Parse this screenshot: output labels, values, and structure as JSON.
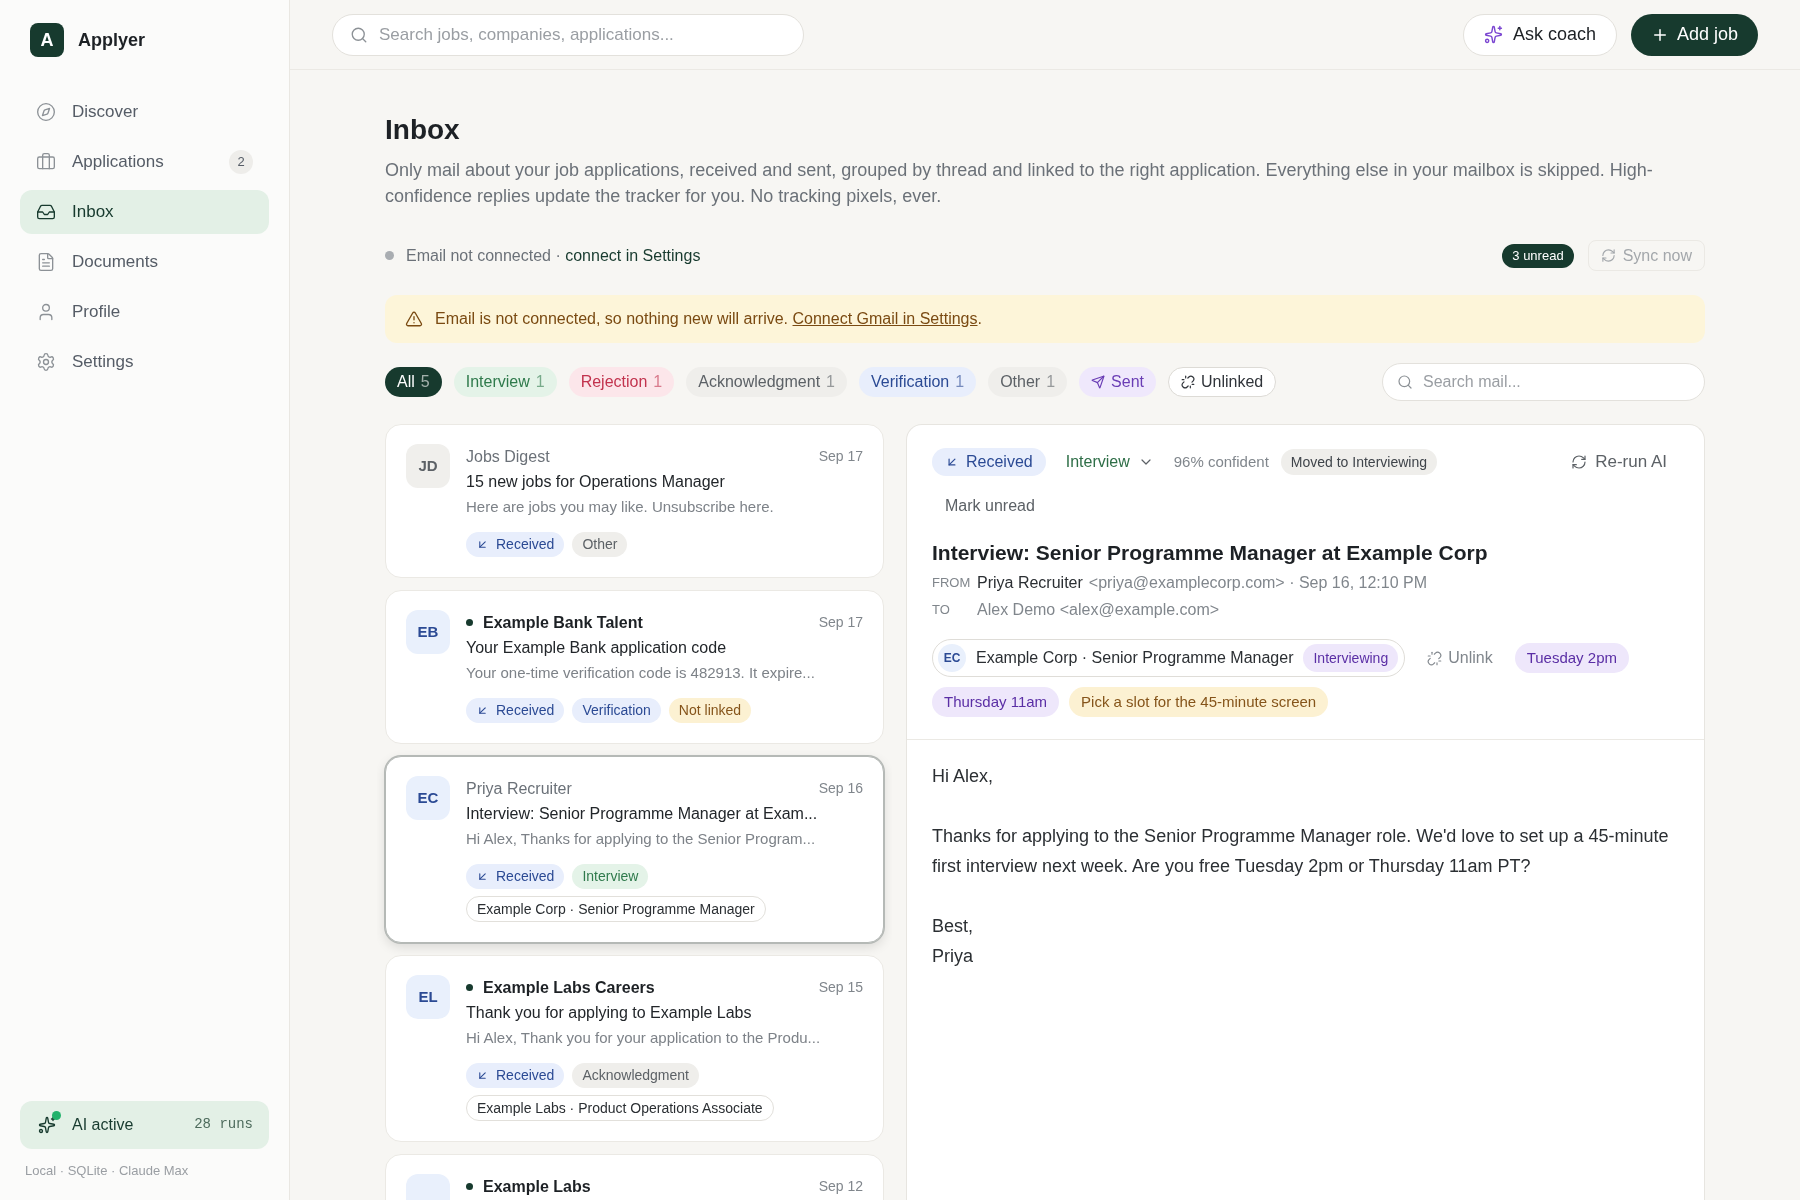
{
  "app": {
    "logo": "A",
    "name": "Applyer"
  },
  "sidebar": {
    "items": [
      {
        "label": "Discover",
        "selected": false
      },
      {
        "label": "Applications",
        "badge": "2",
        "selected": false
      },
      {
        "label": "Inbox",
        "selected": true
      },
      {
        "label": "Documents",
        "selected": false
      },
      {
        "label": "Profile",
        "selected": false
      },
      {
        "label": "Settings",
        "selected": false
      }
    ],
    "ai_status": {
      "label": "AI active",
      "runs": "28 runs",
      "active": true
    },
    "footer": "Local · SQLite · Claude Max"
  },
  "topbar": {
    "search": {
      "placeholder": "Search jobs, companies, applications..."
    },
    "buttons": [
      {
        "label": "Ask coach",
        "kind": "secondary"
      },
      {
        "label": "Add job",
        "kind": "primary"
      }
    ]
  },
  "page": {
    "title": "Inbox",
    "description": "Only mail about your job applications, received and sent, grouped by thread and linked to the right application. Everything else in your mailbox is skipped. High-confidence replies update the tracker for you. No tracking pixels, ever.",
    "connection": {
      "connected": false,
      "status": "Email not connected ·",
      "link": "connect in Settings"
    },
    "unread": "3 unread",
    "sync": {
      "label": "Sync now",
      "disabled": true
    },
    "alert": {
      "text": "Email is not connected, so nothing new will arrive.",
      "link": "Connect Gmail in Settings",
      "after": "."
    }
  },
  "filters": {
    "tabs": [
      {
        "label": "All",
        "count": "5",
        "kind": "all",
        "selected": true
      },
      {
        "label": "Interview",
        "count": "1",
        "kind": "interview",
        "selected": false
      },
      {
        "label": "Rejection",
        "count": "1",
        "kind": "rejection",
        "selected": false
      },
      {
        "label": "Acknowledgment",
        "count": "1",
        "kind": "neutral",
        "selected": false
      },
      {
        "label": "Verification",
        "count": "1",
        "kind": "verification",
        "selected": false
      },
      {
        "label": "Other",
        "count": "1",
        "kind": "neutral",
        "selected": false
      },
      {
        "label": "Sent",
        "kind": "sent",
        "selected": false
      },
      {
        "label": "Unlinked",
        "kind": "unlinked",
        "selected": false
      }
    ],
    "search": {
      "placeholder": "Search mail..."
    }
  },
  "messages": [
    {
      "avatar": {
        "initials": "JD",
        "kind": "neutral"
      },
      "sender": "Jobs Digest",
      "date": "Sep 17",
      "subject": "15 new jobs for Operations Manager",
      "preview": "Here are jobs you may like. Unsubscribe here.",
      "unread": false,
      "selected": false,
      "tags": [
        {
          "label": "Received",
          "kind": "received"
        },
        {
          "label": "Other",
          "kind": "neutral"
        }
      ]
    },
    {
      "avatar": {
        "initials": "EB",
        "kind": "company"
      },
      "sender": "Example Bank Talent",
      "date": "Sep 17",
      "subject": "Your Example Bank application code",
      "preview": "Your one-time verification code is 482913. It expire...",
      "unread": true,
      "selected": false,
      "tags": [
        {
          "label": "Received",
          "kind": "received"
        },
        {
          "label": "Verification",
          "kind": "verification"
        },
        {
          "label": "Not linked",
          "kind": "warning"
        }
      ]
    },
    {
      "avatar": {
        "initials": "EC",
        "kind": "company"
      },
      "sender": "Priya Recruiter",
      "date": "Sep 16",
      "subject": "Interview: Senior Programme Manager at Exam...",
      "preview": "Hi Alex, Thanks for applying to the Senior Program...",
      "unread": false,
      "selected": true,
      "tags": [
        {
          "label": "Received",
          "kind": "received"
        },
        {
          "label": "Interview",
          "kind": "interview"
        }
      ],
      "application": "Example Corp · Senior Programme Manager"
    },
    {
      "avatar": {
        "initials": "EL",
        "kind": "company"
      },
      "sender": "Example Labs Careers",
      "date": "Sep 15",
      "subject": "Thank you for applying to Example Labs",
      "preview": "Hi Alex, Thank you for your application to the Produ...",
      "unread": true,
      "selected": false,
      "tags": [
        {
          "label": "Received",
          "kind": "received"
        },
        {
          "label": "Acknowledgment",
          "kind": "neutral"
        }
      ],
      "application": "Example Labs · Product Operations Associate"
    },
    {
      "avatar": {
        "kind": "company"
      },
      "sender": "Example Labs",
      "date": "Sep 12",
      "unread": true,
      "selected": false
    }
  ],
  "detail": {
    "direction": {
      "label": "Received",
      "kind": "received"
    },
    "category": "Interview",
    "confidence": "96% confident",
    "status_change": "Moved to Interviewing",
    "rerun": "Re-run AI",
    "mark_unread": "Mark unread",
    "subject": "Interview: Senior Programme Manager at Example Corp",
    "from": {
      "label": "FROM",
      "name": "Priya Recruiter",
      "address": "<priya@examplecorp.com> · Sep 16, 12:10 PM"
    },
    "to": {
      "label": "TO",
      "address": "Alex Demo <alex@example.com>"
    },
    "application": {
      "initials": "EC",
      "name": "Example Corp · Senior Programme Manager",
      "stage": "Interviewing"
    },
    "unlink": "Unlink",
    "chips": [
      {
        "label": "Tuesday 2pm",
        "kind": "slot"
      },
      {
        "label": "Thursday 11am",
        "kind": "slot"
      },
      {
        "label": "Pick a slot for the 45-minute screen",
        "kind": "warning"
      }
    ],
    "body": [
      [
        "Hi Alex,"
      ],
      [
        "Thanks for applying to the Senior Programme Manager role. We'd love to set up a 45-minute first interview next week. Are you free Tuesday 2pm or Thursday 11am PT?"
      ],
      [
        "Best,",
        "Priya"
      ]
    ]
  }
}
